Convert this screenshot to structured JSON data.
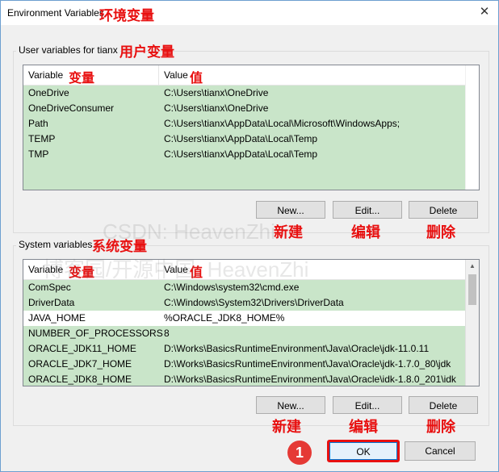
{
  "window": {
    "title": "Environment Variables",
    "title_annotation": "环境变量",
    "close_glyph": "✕"
  },
  "user_section": {
    "label": "User variables for tianx",
    "label_annotation": "用户变量",
    "columns": {
      "variable": "Variable",
      "value": "Value"
    },
    "column_annotations": {
      "variable": "变量",
      "value": "值"
    },
    "rows": [
      {
        "variable": "OneDrive",
        "value": "C:\\Users\\tianx\\OneDrive"
      },
      {
        "variable": "OneDriveConsumer",
        "value": "C:\\Users\\tianx\\OneDrive"
      },
      {
        "variable": "Path",
        "value": "C:\\Users\\tianx\\AppData\\Local\\Microsoft\\WindowsApps;"
      },
      {
        "variable": "TEMP",
        "value": "C:\\Users\\tianx\\AppData\\Local\\Temp"
      },
      {
        "variable": "TMP",
        "value": "C:\\Users\\tianx\\AppData\\Local\\Temp"
      }
    ],
    "buttons": {
      "new": "New...",
      "edit": "Edit...",
      "delete": "Delete"
    },
    "button_annotations": {
      "new": "新建",
      "edit": "编辑",
      "delete": "删除"
    }
  },
  "system_section": {
    "label": "System variables",
    "label_annotation": "系统变量",
    "columns": {
      "variable": "Variable",
      "value": "Value"
    },
    "column_annotations": {
      "variable": "变量",
      "value": "值"
    },
    "rows": [
      {
        "variable": "ComSpec",
        "value": "C:\\Windows\\system32\\cmd.exe"
      },
      {
        "variable": "DriverData",
        "value": "C:\\Windows\\System32\\Drivers\\DriverData"
      },
      {
        "variable": "JAVA_HOME",
        "value": "%ORACLE_JDK8_HOME%"
      },
      {
        "variable": "NUMBER_OF_PROCESSORS",
        "value": "8"
      },
      {
        "variable": "ORACLE_JDK11_HOME",
        "value": "D:\\Works\\BasicsRuntimeEnvironment\\Java\\Oracle\\jdk-11.0.11"
      },
      {
        "variable": "ORACLE_JDK7_HOME",
        "value": "D:\\Works\\BasicsRuntimeEnvironment\\Java\\Oracle\\jdk-1.7.0_80\\jdk"
      },
      {
        "variable": "ORACLE_JDK8_HOME",
        "value": "D:\\Works\\BasicsRuntimeEnvironment\\Java\\Oracle\\idk-1.8.0_201\\idk"
      }
    ],
    "buttons": {
      "new": "New...",
      "edit": "Edit...",
      "delete": "Delete"
    },
    "button_annotations": {
      "new": "新建",
      "edit": "编辑",
      "delete": "删除"
    }
  },
  "footer": {
    "ok": "OK",
    "cancel": "Cancel",
    "step_number": "1"
  },
  "watermark": {
    "line1": "CSDN: HeavenZhi",
    "line2": "博客园/开源中国: HeavenZhi"
  },
  "colors": {
    "row_highlight": "#c9e5c9",
    "annotation": "#e81010"
  }
}
